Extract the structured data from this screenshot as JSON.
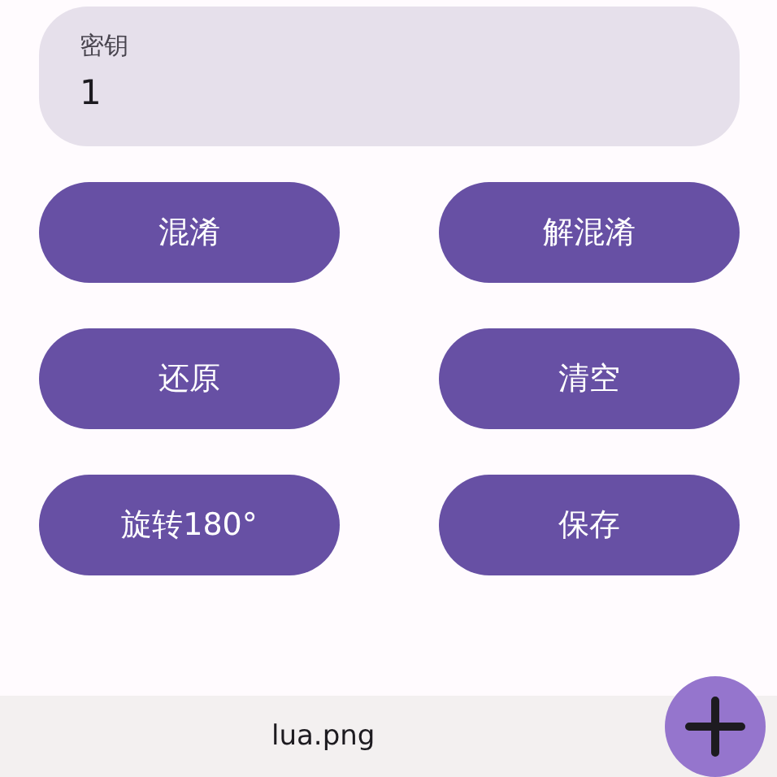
{
  "key_field": {
    "label": "密钥",
    "value": "1"
  },
  "buttons": [
    {
      "label": "混淆"
    },
    {
      "label": "解混淆"
    },
    {
      "label": "还原"
    },
    {
      "label": "清空"
    },
    {
      "label": "旋转180°"
    },
    {
      "label": "保存"
    }
  ],
  "bottom_bar": {
    "file_name": "lua.png"
  }
}
